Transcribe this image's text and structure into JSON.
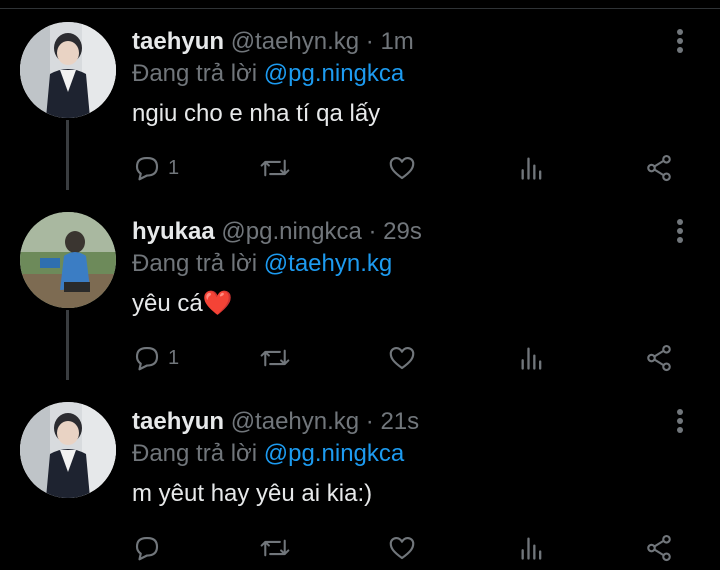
{
  "tweets": [
    {
      "name": "taehyun",
      "handle": "@taehyn.kg",
      "time": "· 1m",
      "replying_prefix": "Đang trả lời",
      "replying_to": "@pg.ningkca",
      "text": "ngiu cho e nha tí qa lấy",
      "reply_count": "1",
      "avatar": "boy-in-school-uniform"
    },
    {
      "name": "hyukaa",
      "handle": "@pg.ningkca",
      "time": "· 29s",
      "replying_prefix": "Đang trả lời",
      "replying_to": "@taehyn.kg",
      "text": "yêu cá❤️",
      "reply_count": "1",
      "avatar": "person-crouching-outdoors"
    },
    {
      "name": "taehyun",
      "handle": "@taehyn.kg",
      "time": "· 21s",
      "replying_prefix": "Đang trả lời",
      "replying_to": "@pg.ningkca",
      "text": "m yêut hay yêu ai kia:)",
      "reply_count": "",
      "avatar": "boy-in-school-uniform"
    }
  ],
  "icons": [
    "reply-icon",
    "retweet-icon",
    "like-icon",
    "views-icon",
    "share-icon",
    "more-icon"
  ],
  "colors": {
    "background": "#000000",
    "text": "#e7e9ea",
    "muted": "#71767b",
    "link": "#1d9bf0"
  }
}
